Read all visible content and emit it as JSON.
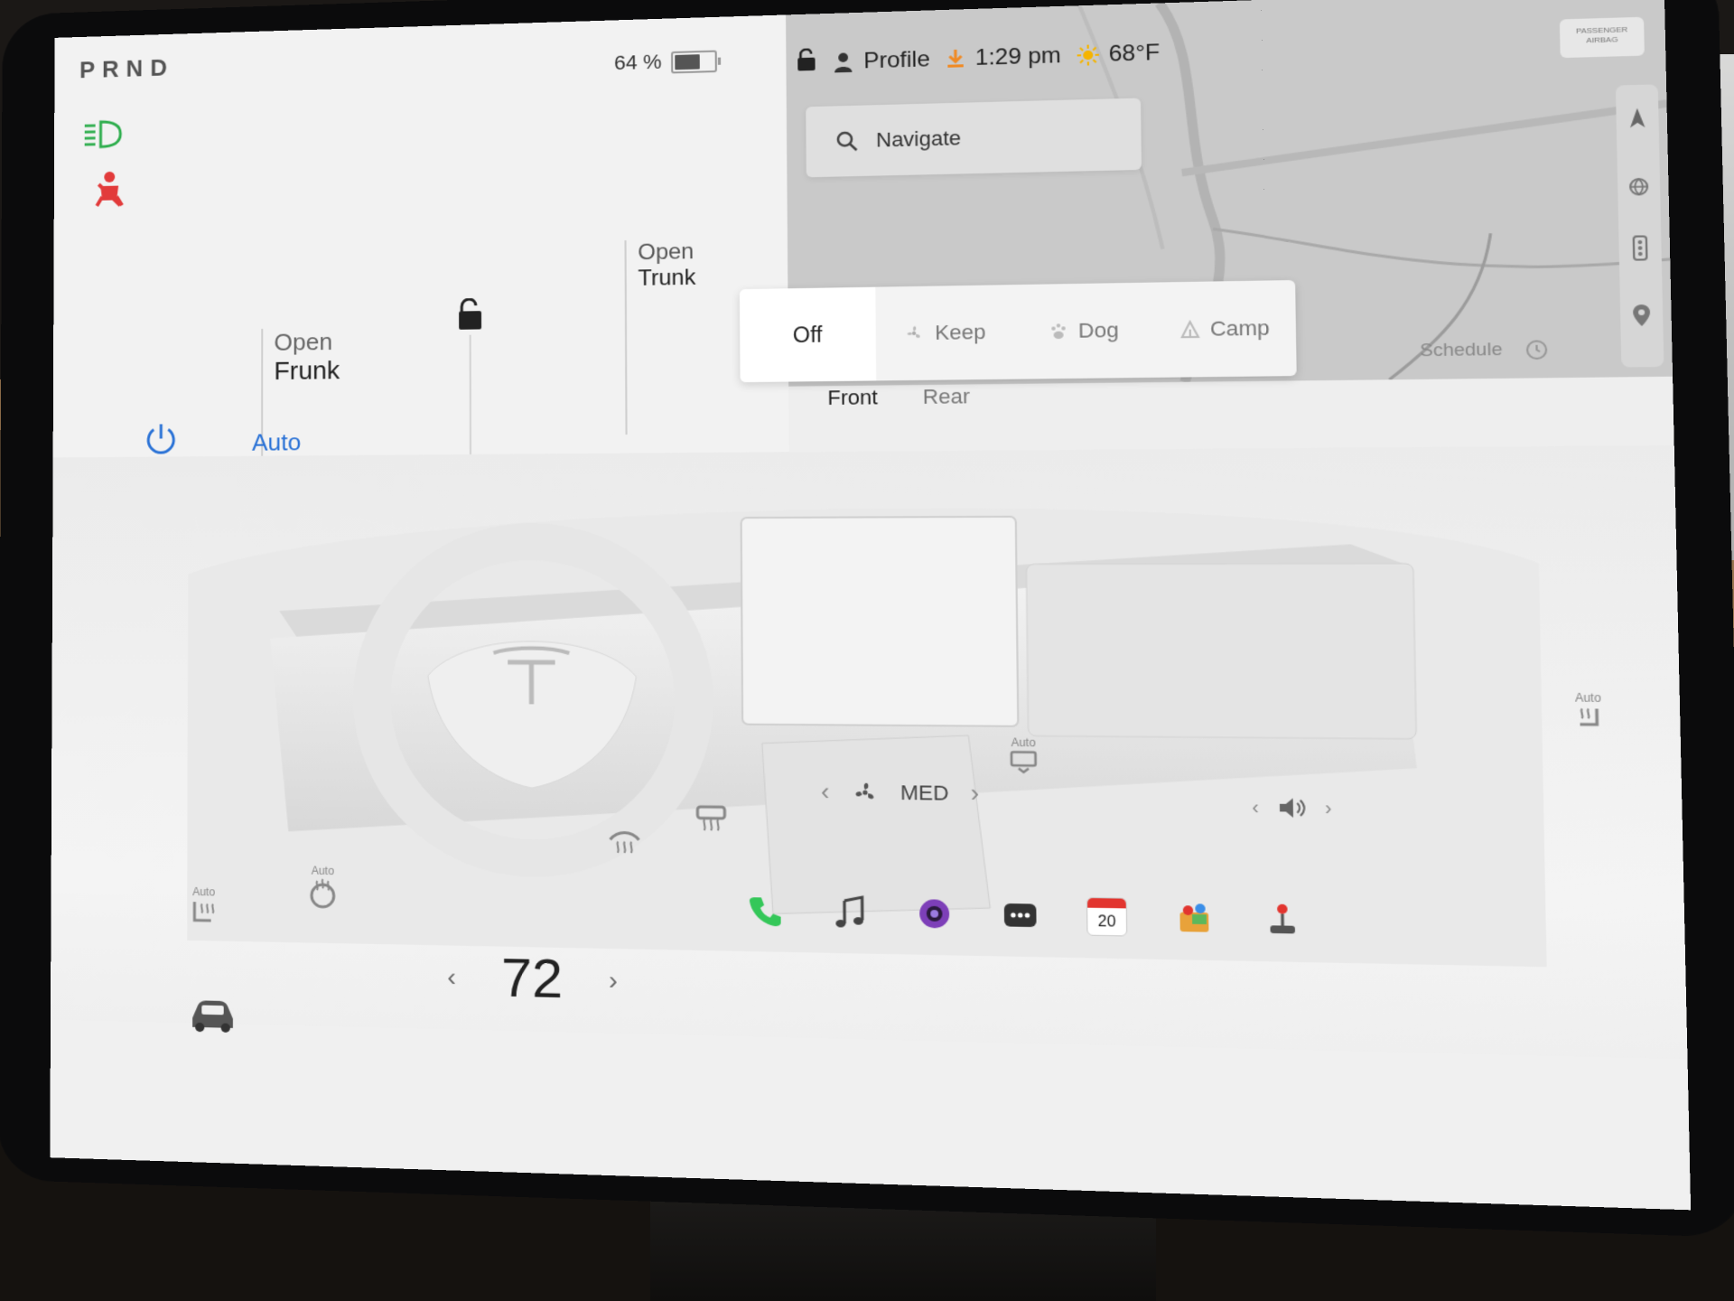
{
  "status": {
    "gear": "PRND",
    "battery_pct": "64 %",
    "battery_level": 0.64,
    "profile": "Profile",
    "time": "1:29 pm",
    "temperature_outside": "68°F",
    "airbag_line1": "PASSENGER",
    "airbag_line2": "AIRBAG"
  },
  "vehicle": {
    "frunk_line1": "Open",
    "frunk_line2": "Frunk",
    "trunk_line1": "Open",
    "trunk_line2": "Trunk"
  },
  "map": {
    "search_placeholder": "Navigate"
  },
  "climate_modes": {
    "items": [
      {
        "label": "Off",
        "active": true
      },
      {
        "label": "Keep",
        "active": false
      },
      {
        "label": "Dog",
        "active": false
      },
      {
        "label": "Camp",
        "active": false
      }
    ]
  },
  "climate": {
    "schedule_label": "Schedule",
    "tab_front": "Front",
    "tab_rear": "Rear",
    "auto_label": "Auto",
    "fan_speed": "MED",
    "seat_auto_label": "Auto",
    "wheel_auto_label": "Auto",
    "rear_defrost_auto": "Auto",
    "right_seat_auto": "Auto",
    "cabin_temp": "72"
  },
  "dock": {
    "calendar_day": "20"
  },
  "colors": {
    "accent_blue": "#2a72d6",
    "headlight_green": "#2fae4e",
    "seatbelt_red": "#e23b3b",
    "phone_green": "#34c759"
  }
}
